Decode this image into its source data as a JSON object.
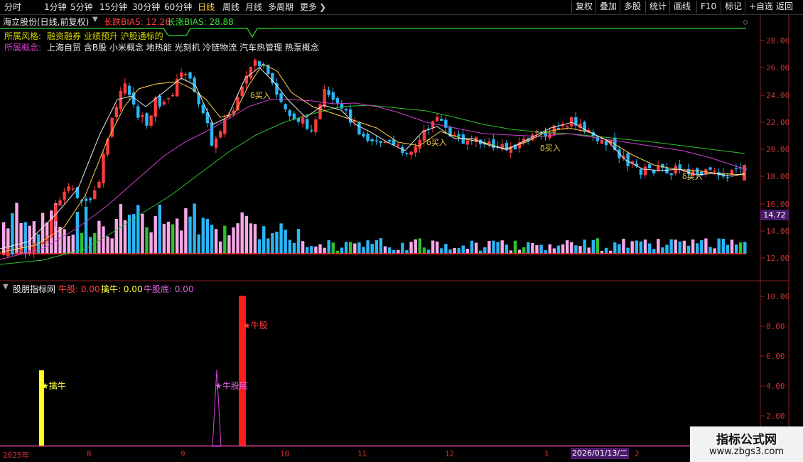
{
  "toolbar": {
    "periods": [
      "分时",
      "1分钟",
      "5分钟",
      "15分钟",
      "30分钟",
      "60分钟",
      "日线",
      "周线",
      "月线",
      "多周期",
      "更多"
    ],
    "active_period": "日线",
    "right_buttons": [
      "复权",
      "叠加",
      "多股",
      "统计",
      "画线",
      "F10",
      "标记",
      "+自选",
      "返回"
    ]
  },
  "main_panel": {
    "stock_title": "海立股份(日线,前复权)",
    "bias_short": "长跌BIAS: 12.26",
    "bias_long": "长涨BIAS: 28.88",
    "style_label": "所属风格:",
    "style_value": "融资融券 业绩预升 沪股通标的",
    "concept_label": "所属概念:",
    "concept_value": "上海自贸 含B股 小米概念 地热能 光刻机 冷链物流 汽车热管理 热泵概念",
    "buy_signals": [
      "δ买入",
      "δ买入",
      "δ买入",
      "δ买入"
    ],
    "price_tag": "14.72",
    "y_ticks": [
      "28.00",
      "26.00",
      "24.00",
      "22.00",
      "20.00",
      "18.00",
      "16.00",
      "14.00",
      "12.00"
    ]
  },
  "sub_panel": {
    "indicator_name": "股朋指标网",
    "niugu": "牛股: 0.00",
    "qiniu": "擒牛: 0.00",
    "niugudi": "牛股底: 0.00",
    "annotations": [
      "擒牛",
      "牛股底",
      "牛股"
    ],
    "y_ticks": [
      "10.00",
      "8.00",
      "6.00",
      "4.00",
      "2.00"
    ]
  },
  "x_axis": {
    "labels": [
      "2025年",
      "8",
      "9",
      "10",
      "11",
      "12",
      "1",
      "2"
    ],
    "date_cursor": "2026/01/13/二"
  },
  "watermark": {
    "title": "指标公式网",
    "url": "www.zbgs3.com"
  },
  "colors": {
    "up": "#ff3b3b",
    "down": "#29b6f6",
    "ma_yellow": "#ffd24d",
    "ma_magenta": "#d040d0",
    "ma_green": "#30c030",
    "axis": "#cc3333"
  }
}
